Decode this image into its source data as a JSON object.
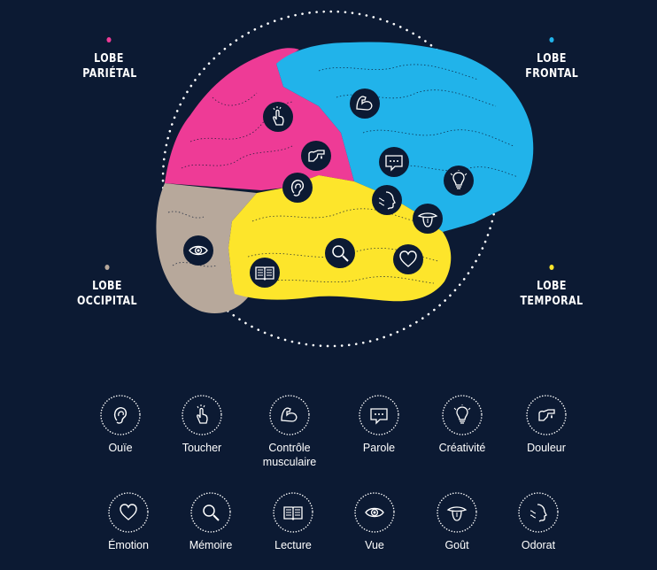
{
  "colors": {
    "background": "#0c1a33",
    "parietal": "#ee3b96",
    "frontal": "#21b3ea",
    "occipital": "#b7a89b",
    "temporal": "#fde52b",
    "icon_circle": "#0c1a33"
  },
  "lobes": {
    "parietal": {
      "line1": "LOBE",
      "line2": "PARIÉTAL"
    },
    "frontal": {
      "line1": "LOBE",
      "line2": "FRONTAL"
    },
    "occipital": {
      "line1": "LOBE",
      "line2": "OCCIPITAL"
    },
    "temporal": {
      "line1": "LOBE",
      "line2": "TEMPORAL"
    }
  },
  "legend": [
    {
      "icon": "ear-icon",
      "label": "Ouïe"
    },
    {
      "icon": "touch-icon",
      "label": "Toucher"
    },
    {
      "icon": "muscle-icon",
      "label": "Contrôle musculaire"
    },
    {
      "icon": "speech-bubble-icon",
      "label": "Parole"
    },
    {
      "icon": "lightbulb-icon",
      "label": "Créativité"
    },
    {
      "icon": "pain-icon",
      "label": "Douleur"
    },
    {
      "icon": "heart-icon",
      "label": "Émotion"
    },
    {
      "icon": "magnifier-icon",
      "label": "Mémoire"
    },
    {
      "icon": "book-icon",
      "label": "Lecture"
    },
    {
      "icon": "eye-icon",
      "label": "Vue"
    },
    {
      "icon": "tongue-icon",
      "label": "Goût"
    },
    {
      "icon": "smell-icon",
      "label": "Odorat"
    }
  ]
}
